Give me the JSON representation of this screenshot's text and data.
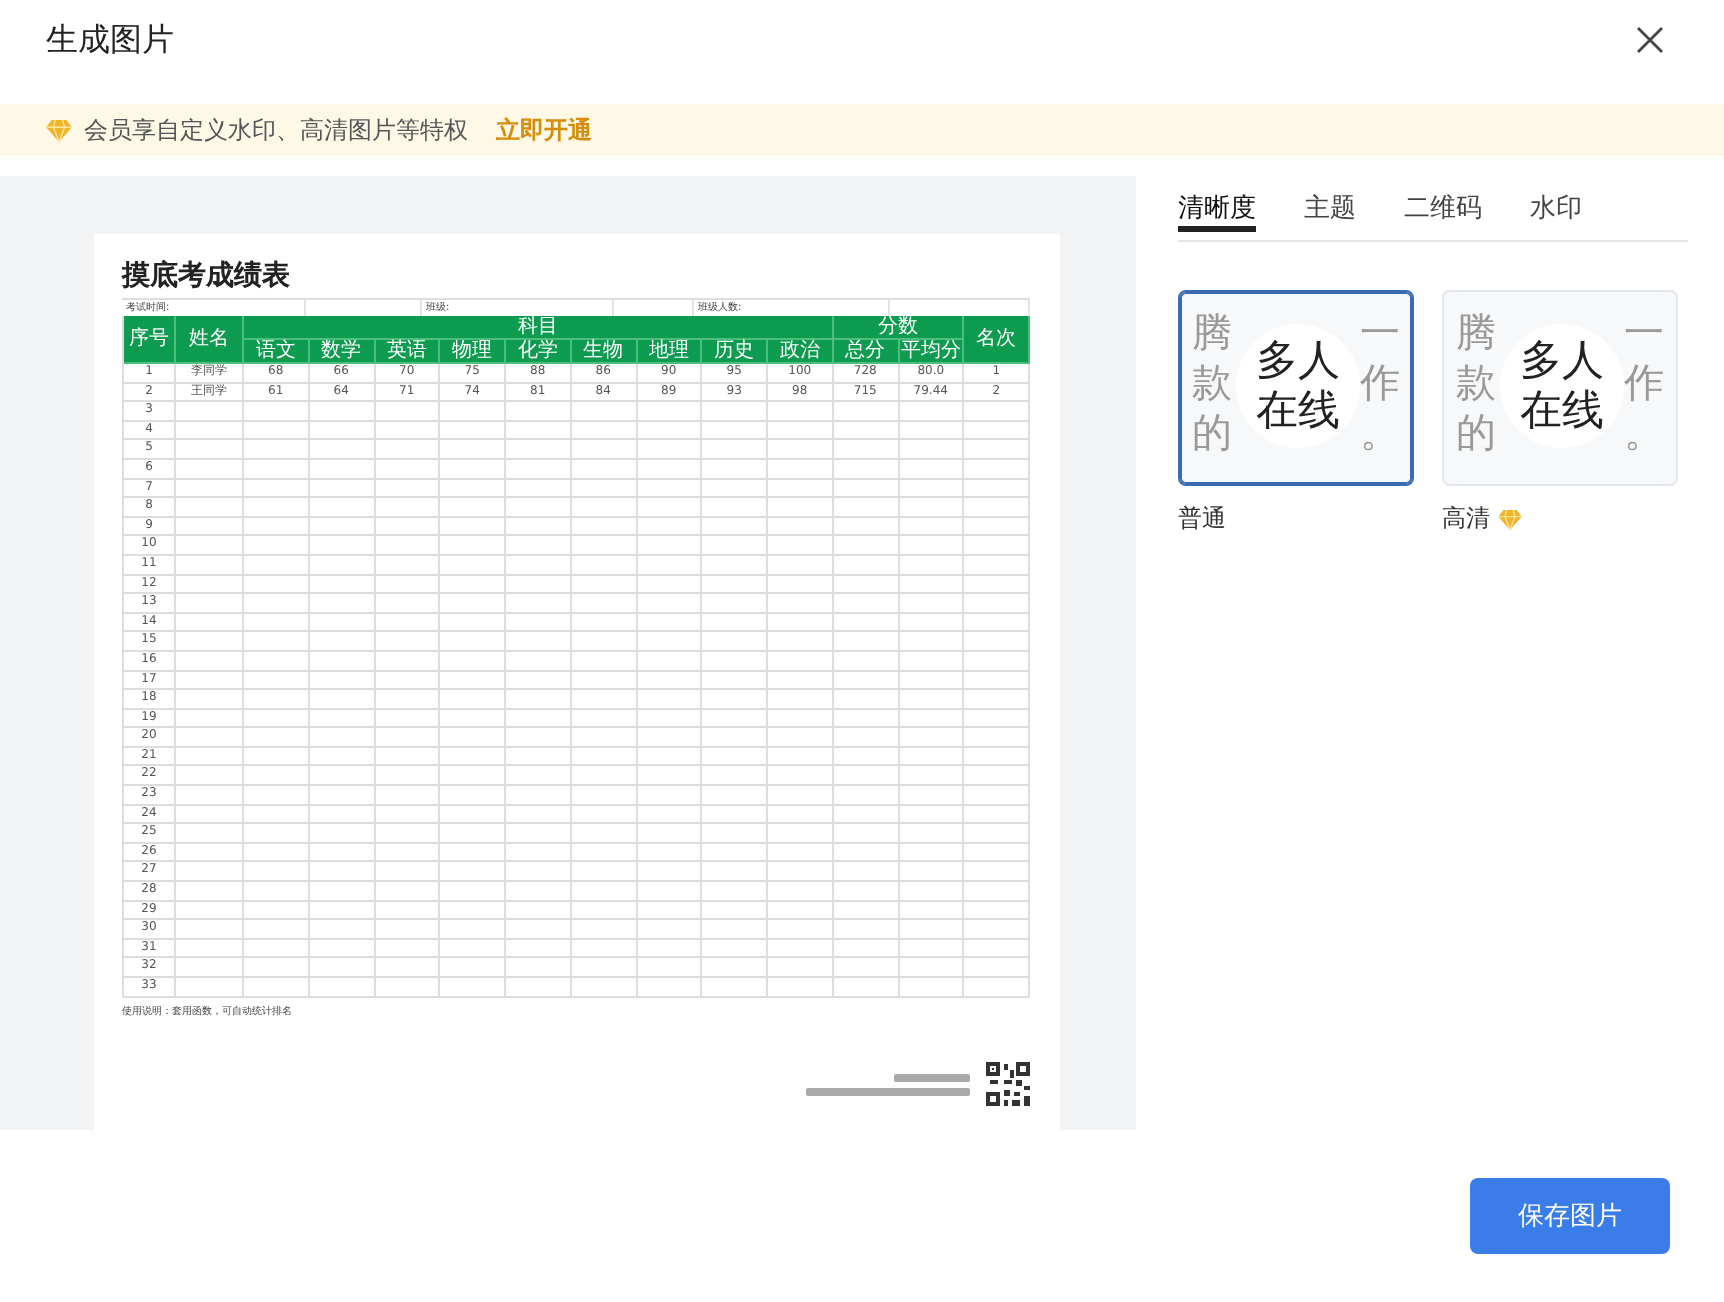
{
  "dialog": {
    "title": "生成图片"
  },
  "banner": {
    "text": "会员享自定义水印、高清图片等特权",
    "link": "立即开通"
  },
  "preview": {
    "sheet_title": "摸底考成绩表",
    "info": [
      "考试时间:",
      "班级:",
      "班级人数:"
    ],
    "header_groups": [
      {
        "label": "序号"
      },
      {
        "label": "姓名"
      },
      {
        "label": "科目",
        "children": [
          "语文",
          "数学",
          "英语",
          "物理",
          "化学",
          "生物",
          "地理",
          "历史",
          "政治"
        ]
      },
      {
        "label": "分数",
        "children": [
          "总分",
          "平均分"
        ]
      },
      {
        "label": "名次"
      }
    ],
    "rows": [
      [
        "1",
        "李同学",
        "68",
        "66",
        "70",
        "75",
        "88",
        "86",
        "90",
        "95",
        "100",
        "728",
        "80.0",
        "1"
      ],
      [
        "2",
        "王同学",
        "61",
        "64",
        "71",
        "74",
        "81",
        "84",
        "89",
        "93",
        "98",
        "715",
        "79.44",
        "2"
      ]
    ],
    "blank_rows": [
      "3",
      "4",
      "5",
      "6",
      "7",
      "8",
      "9",
      "10",
      "11",
      "12",
      "13",
      "14",
      "15",
      "16",
      "17",
      "18",
      "19",
      "20",
      "21",
      "22",
      "23",
      "24",
      "25",
      "26",
      "27",
      "28",
      "29",
      "30",
      "31",
      "32",
      "33"
    ],
    "note": "使用说明：套用函数，可自动统计排名"
  },
  "tabs": [
    {
      "label": "清晰度",
      "selected": true
    },
    {
      "label": "主题",
      "selected": false
    },
    {
      "label": "二维码",
      "selected": false
    },
    {
      "label": "水印",
      "selected": false
    }
  ],
  "quality_options": [
    {
      "label": "普通",
      "selected": true,
      "premium": false,
      "circle": [
        "多人",
        "在线"
      ],
      "lines": [
        [
          "腾",
          "一"
        ],
        [
          "款",
          "作"
        ],
        [
          "的",
          "。"
        ]
      ]
    },
    {
      "label": "高清",
      "selected": false,
      "premium": true,
      "circle": [
        "多人",
        "在线"
      ],
      "lines": [
        [
          "腾",
          "一"
        ],
        [
          "款",
          "作"
        ],
        [
          "的",
          "。"
        ]
      ]
    }
  ],
  "save_button": "保存图片"
}
